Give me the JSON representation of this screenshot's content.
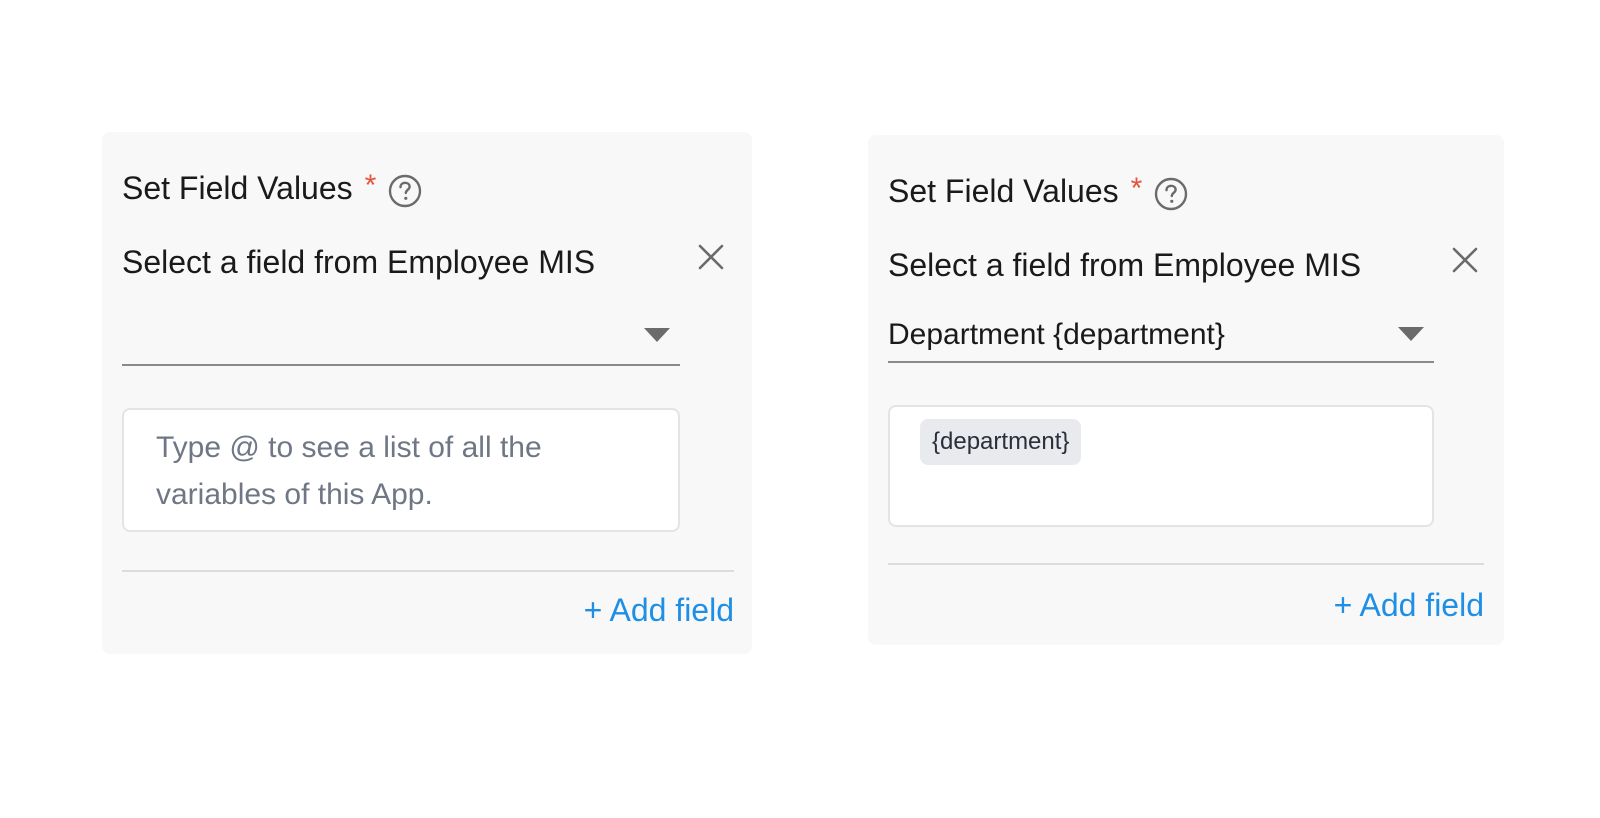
{
  "panels": [
    {
      "section_title": "Set Field Values",
      "required_mark": "*",
      "field_label": "Select a field from Employee MIS",
      "selected_field": "",
      "input_placeholder": "Type @ to see a list of all the variables of this App.",
      "input_chip": "",
      "add_field_label": "+ Add field"
    },
    {
      "section_title": "Set Field Values",
      "required_mark": "*",
      "field_label": "Select a field from Employee MIS",
      "selected_field": "Department {department}",
      "input_placeholder": "",
      "input_chip": "{department}",
      "add_field_label": "+ Add field"
    }
  ],
  "colors": {
    "accent": "#1f8fe6",
    "required": "#e5533d",
    "panel_bg": "#f8f8f8"
  },
  "icons": {
    "help": "help-circle-icon",
    "close": "close-icon",
    "dropdown": "chevron-down-icon"
  }
}
